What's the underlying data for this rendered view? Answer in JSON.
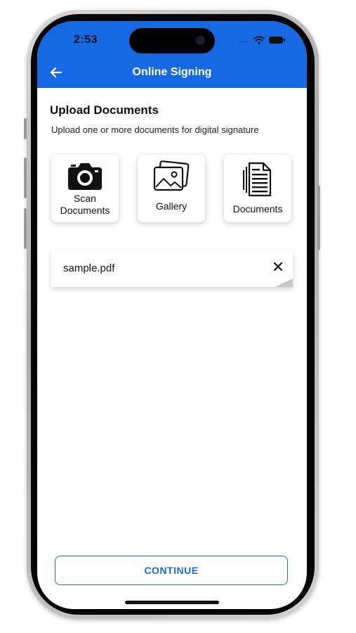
{
  "status_bar": {
    "time": "2:53",
    "dots": "...."
  },
  "header": {
    "title": "Online Signing",
    "back_icon": "arrow-left-icon"
  },
  "upload": {
    "title": "Upload Documents",
    "subtitle": "Upload one or more documents for digital signature",
    "options": [
      {
        "label_line1": "Scan",
        "label_line2": "Documents",
        "icon": "camera-icon"
      },
      {
        "label": "Gallery",
        "icon": "image-gallery-icon"
      },
      {
        "label": "Documents",
        "icon": "document-icon"
      }
    ]
  },
  "files": [
    {
      "name": "sample.pdf",
      "remove_icon": "close-icon"
    }
  ],
  "footer": {
    "continue_label": "CONTINUE"
  },
  "colors": {
    "accent": "#1668e3",
    "header_bg": "#1668e3"
  }
}
